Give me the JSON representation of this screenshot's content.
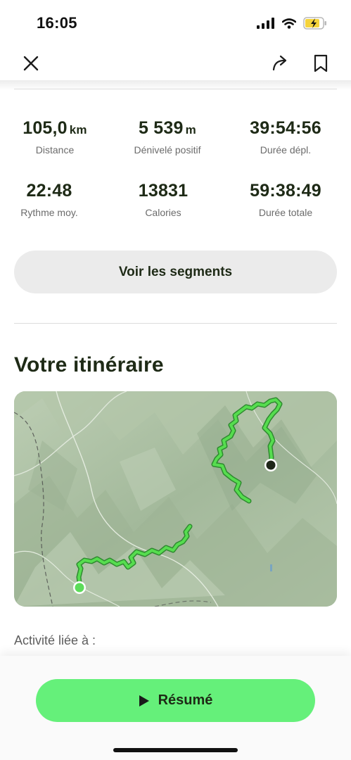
{
  "status_bar": {
    "time": "16:05"
  },
  "stats": [
    {
      "value": "105,0",
      "unit": "km",
      "label": "Distance"
    },
    {
      "value": "5 539",
      "unit": "m",
      "label": "Dénivelé positif"
    },
    {
      "value": "39:54:56",
      "unit": "",
      "label": "Durée dépl."
    },
    {
      "value": "22:48",
      "unit": "",
      "label": "Rythme moy."
    },
    {
      "value": "13831",
      "unit": "",
      "label": "Calories"
    },
    {
      "value": "59:38:49",
      "unit": "",
      "label": "Durée totale"
    }
  ],
  "segments_button": {
    "label": "Voir les segments"
  },
  "route_section": {
    "title": "Votre itinéraire"
  },
  "linked_activity": {
    "label": "Activité liée à :"
  },
  "resume_button": {
    "label": "Résumé"
  },
  "icons": {
    "close": "close-icon",
    "share": "share-icon",
    "bookmark": "bookmark-icon",
    "play": "play-icon",
    "signal": "signal-icon",
    "wifi": "wifi-icon",
    "battery": "battery-charging-icon"
  },
  "colors": {
    "accent_green": "#65f07a",
    "route_green": "#52d84e",
    "map_base": "#a9bea1",
    "text_dark": "#1e2a16",
    "battery_yellow": "#f5d33b"
  }
}
